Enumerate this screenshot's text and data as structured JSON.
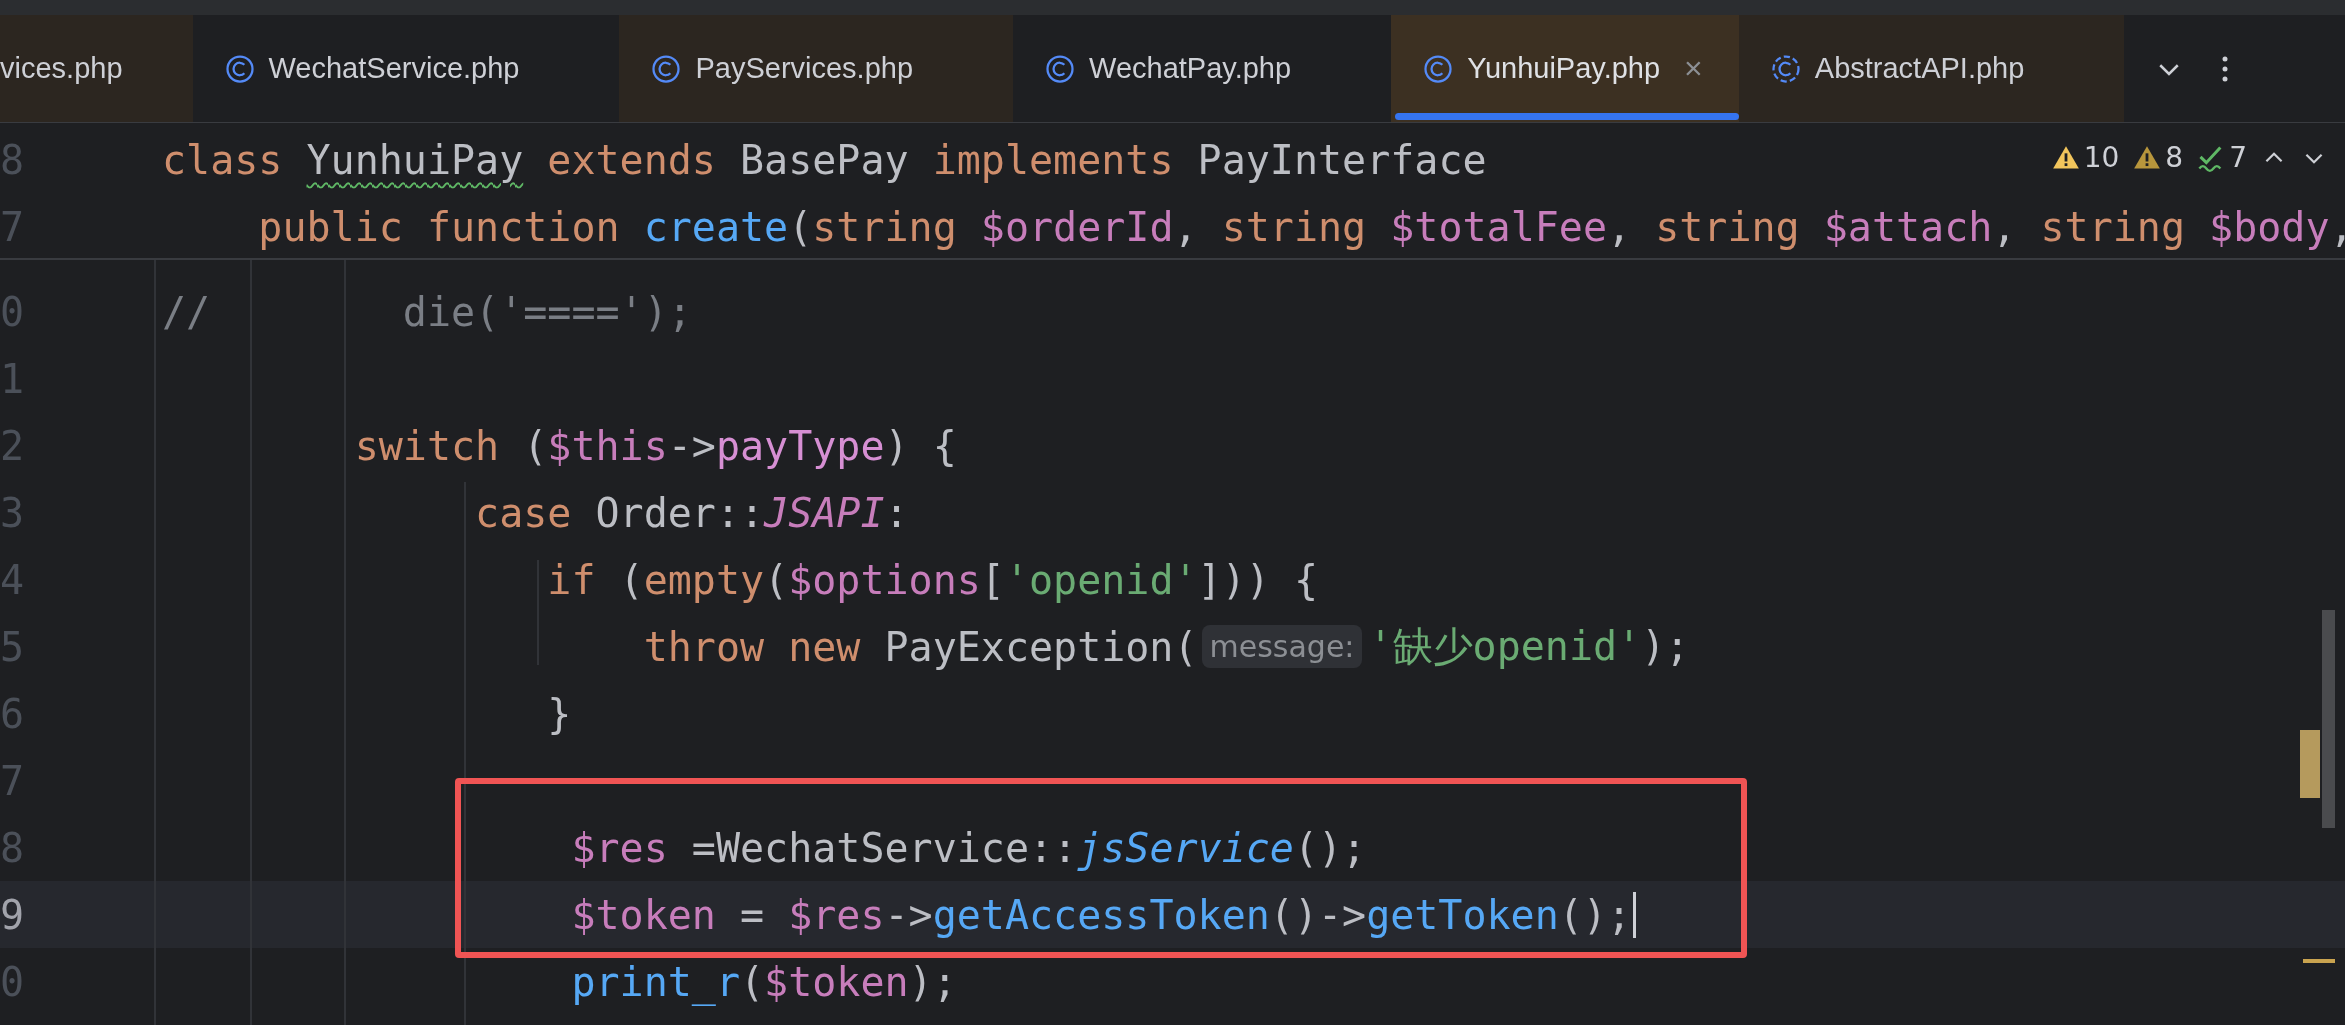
{
  "tabs": [
    {
      "label": "vices.php",
      "kind": "cut",
      "tinted": true,
      "selected": false,
      "closable": false
    },
    {
      "label": "WechatService.php",
      "kind": "class",
      "tinted": false,
      "selected": false,
      "closable": false
    },
    {
      "label": "PayServices.php",
      "kind": "class",
      "tinted": true,
      "selected": false,
      "closable": false
    },
    {
      "label": "WechatPay.php",
      "kind": "class",
      "tinted": false,
      "selected": false,
      "closable": false
    },
    {
      "label": "YunhuiPay.php",
      "kind": "class",
      "tinted": true,
      "selected": true,
      "closable": true
    },
    {
      "label": "AbstractAPI.php",
      "kind": "abstract",
      "tinted": true,
      "selected": false,
      "closable": false
    }
  ],
  "close_glyph": "×",
  "inspections": [
    {
      "kind": "warning",
      "count": "10"
    },
    {
      "kind": "weak_warning",
      "count": "8"
    },
    {
      "kind": "typo",
      "count": "7"
    }
  ],
  "sticky_lines": [
    {
      "number": "8",
      "current": false,
      "segments": [
        {
          "kind": "code",
          "tokens": [
            {
              "t": "class ",
              "kind": "keyword"
            },
            {
              "t": "YunhuiPay",
              "kind": "plain",
              "typo": true
            },
            {
              "t": " extends ",
              "kind": "keyword"
            },
            {
              "t": "BasePay ",
              "kind": "plain"
            },
            {
              "t": "implements ",
              "kind": "keyword"
            },
            {
              "t": "PayInterface",
              "kind": "plain"
            }
          ]
        }
      ]
    },
    {
      "number": "7",
      "current": false,
      "segments": [
        {
          "kind": "code",
          "tokens": [
            {
              "t": "    public function ",
              "kind": "keyword"
            },
            {
              "t": "create",
              "kind": "method"
            },
            {
              "t": "(",
              "kind": "plain"
            },
            {
              "t": "string ",
              "kind": "keyword"
            },
            {
              "t": "$orderId",
              "kind": "variable"
            },
            {
              "t": ", ",
              "kind": "plain"
            },
            {
              "t": "string ",
              "kind": "keyword"
            },
            {
              "t": "$totalFee",
              "kind": "variable"
            },
            {
              "t": ", ",
              "kind": "plain"
            },
            {
              "t": "string ",
              "kind": "keyword"
            },
            {
              "t": "$attach",
              "kind": "variable"
            },
            {
              "t": ", ",
              "kind": "plain"
            },
            {
              "t": "string ",
              "kind": "keyword"
            },
            {
              "t": "$body",
              "kind": "variable"
            },
            {
              "t": ",",
              "kind": "plain"
            }
          ]
        }
      ]
    }
  ],
  "lines": [
    {
      "number": "0",
      "current": false,
      "segments": [
        {
          "kind": "code",
          "tokens": [
            {
              "t": "//        die('====');",
              "kind": "comment"
            }
          ]
        }
      ]
    },
    {
      "number": "1",
      "current": false
    },
    {
      "number": "2",
      "current": false,
      "segments": [
        {
          "kind": "code",
          "tokens": [
            {
              "t": "        switch ",
              "kind": "keyword"
            },
            {
              "t": "(",
              "kind": "plain"
            },
            {
              "t": "$this",
              "kind": "variable"
            },
            {
              "t": "->",
              "kind": "plain"
            },
            {
              "t": "payType",
              "kind": "field"
            },
            {
              "t": ") {",
              "kind": "plain"
            }
          ]
        }
      ]
    },
    {
      "number": "3",
      "current": false,
      "segments": [
        {
          "kind": "code",
          "tokens": [
            {
              "t": "             case ",
              "kind": "keyword"
            },
            {
              "t": "Order::",
              "kind": "plain"
            },
            {
              "t": "JSAPI",
              "kind": "constant"
            },
            {
              "t": ":",
              "kind": "plain"
            }
          ]
        }
      ]
    },
    {
      "number": "4",
      "current": false,
      "segments": [
        {
          "kind": "code",
          "tokens": [
            {
              "t": "                if ",
              "kind": "keyword"
            },
            {
              "t": "(",
              "kind": "plain"
            },
            {
              "t": "empty",
              "kind": "keyword"
            },
            {
              "t": "(",
              "kind": "plain"
            },
            {
              "t": "$options",
              "kind": "variable"
            },
            {
              "t": "[",
              "kind": "plain"
            },
            {
              "t": "'openid'",
              "kind": "string"
            },
            {
              "t": "])) {",
              "kind": "plain"
            }
          ]
        }
      ]
    },
    {
      "number": "5",
      "current": false,
      "segments": [
        {
          "kind": "code",
          "tokens": [
            {
              "t": "                    throw new ",
              "kind": "keyword"
            },
            {
              "t": "PayException(",
              "kind": "plain"
            }
          ]
        },
        {
          "kind": "hint",
          "text": "message:"
        },
        {
          "kind": "code",
          "tokens": [
            {
              "t": "'缺少openid'",
              "kind": "string"
            },
            {
              "t": ");",
              "kind": "plain"
            }
          ]
        }
      ]
    },
    {
      "number": "6",
      "current": false,
      "segments": [
        {
          "kind": "code",
          "tokens": [
            {
              "t": "                }",
              "kind": "plain"
            }
          ]
        }
      ]
    },
    {
      "number": "7",
      "current": false
    },
    {
      "number": "8",
      "current": false,
      "segments": [
        {
          "kind": "code",
          "tokens": [
            {
              "t": "                 $res",
              "kind": "variable"
            },
            {
              "t": " =WechatService::",
              "kind": "plain"
            },
            {
              "t": "jsService",
              "kind": "static_method"
            },
            {
              "t": "();",
              "kind": "plain"
            }
          ]
        }
      ]
    },
    {
      "number": "9",
      "current": true,
      "segments": [
        {
          "kind": "code",
          "tokens": [
            {
              "t": "                 $token",
              "kind": "variable"
            },
            {
              "t": " = ",
              "kind": "plain"
            },
            {
              "t": "$res",
              "kind": "variable"
            },
            {
              "t": "->",
              "kind": "plain"
            },
            {
              "t": "getAccessToken",
              "kind": "method"
            },
            {
              "t": "()->",
              "kind": "plain"
            },
            {
              "t": "getToken",
              "kind": "method"
            },
            {
              "t": "();",
              "kind": "plain"
            }
          ]
        },
        {
          "kind": "cursor"
        }
      ]
    },
    {
      "number": "0",
      "current": false,
      "segments": [
        {
          "kind": "code",
          "tokens": [
            {
              "t": "                 print_r",
              "kind": "method"
            },
            {
              "t": "(",
              "kind": "plain"
            },
            {
              "t": "$token",
              "kind": "variable"
            },
            {
              "t": ");",
              "kind": "plain"
            }
          ]
        }
      ]
    }
  ]
}
